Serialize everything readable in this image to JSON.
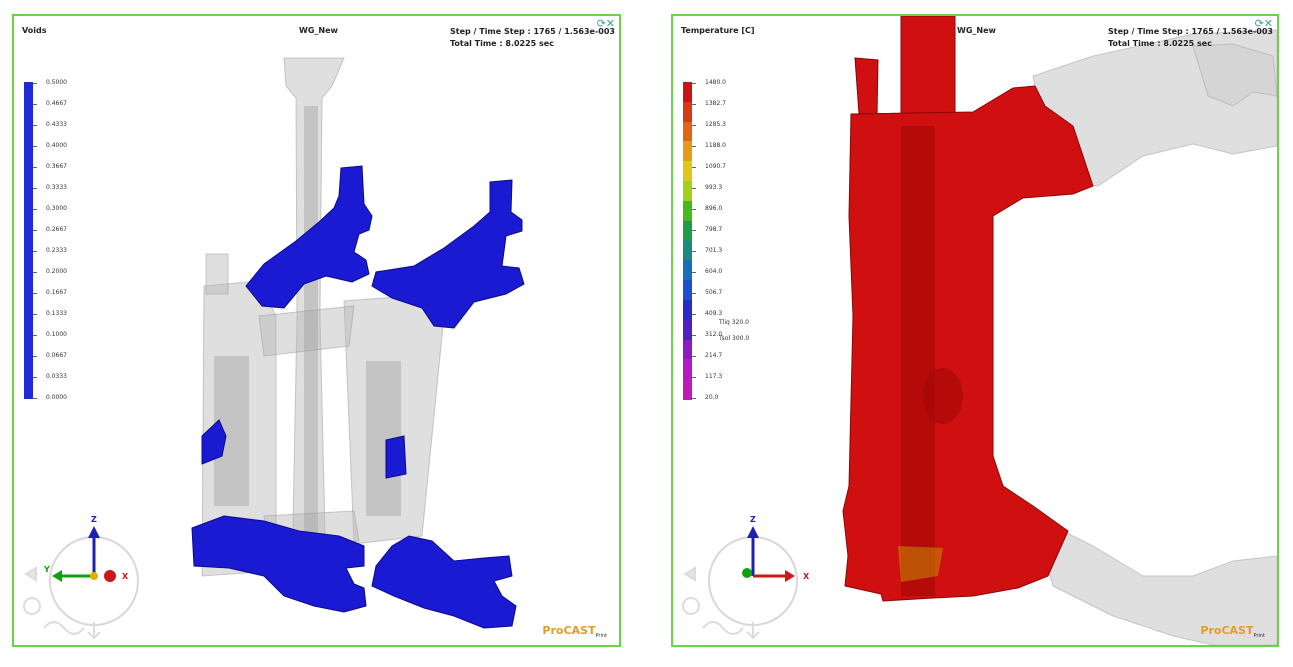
{
  "left_panel": {
    "title": "Voids",
    "model": "WG_New",
    "step_line1": "Step  /  Time  Step : 1765  /  1.563e-003",
    "step_line2": "Total    Time          :  8.0225  sec",
    "legend": {
      "labels": [
        "0.5000",
        "0.4667",
        "0.4333",
        "0.4000",
        "0.3667",
        "0.3333",
        "0.3000",
        "0.2667",
        "0.2333",
        "0.2000",
        "0.1667",
        "0.1333",
        "0.1000",
        "0.0667",
        "0.0333",
        "0.0000"
      ],
      "color": "#1f2ad8"
    },
    "axis": {
      "z": "Z",
      "x": "X",
      "y": "Y"
    },
    "logo": "ProCAST",
    "logo_sub": "Print",
    "icons": [
      "refresh-icon",
      "close-icon"
    ]
  },
  "right_panel": {
    "title": "Temperature  [C]",
    "model": "WG_New",
    "step_line1": "Step  /  Time  Step : 1765  /  1.563e-003",
    "step_line2": "Total    Time          :  8.0225  sec",
    "legend": {
      "labels": [
        "1480.0",
        "1382.7",
        "1285.3",
        "1188.0",
        "1090.7",
        "993.3",
        "896.0",
        "798.7",
        "701.3",
        "604.0",
        "506.7",
        "409.3",
        "312.0",
        "214.7",
        "117.3",
        "20.0"
      ],
      "colors": [
        "#c81414",
        "#d43a14",
        "#e06514",
        "#e79a16",
        "#dfc818",
        "#a4cf1c",
        "#48b81e",
        "#1f9c4a",
        "#1c8a80",
        "#1a6fb8",
        "#1f4ed0",
        "#2a2ac8",
        "#5020c0",
        "#8a1cc0",
        "#b21ac8",
        "#c01ab8"
      ],
      "tliq": "Tliq   320.0",
      "tsol": "Tsol   300.0"
    },
    "axis": {
      "z": "Z",
      "x": "X"
    },
    "logo": "ProCAST",
    "logo_sub": "Print",
    "icons": [
      "refresh-icon",
      "close-icon"
    ]
  }
}
